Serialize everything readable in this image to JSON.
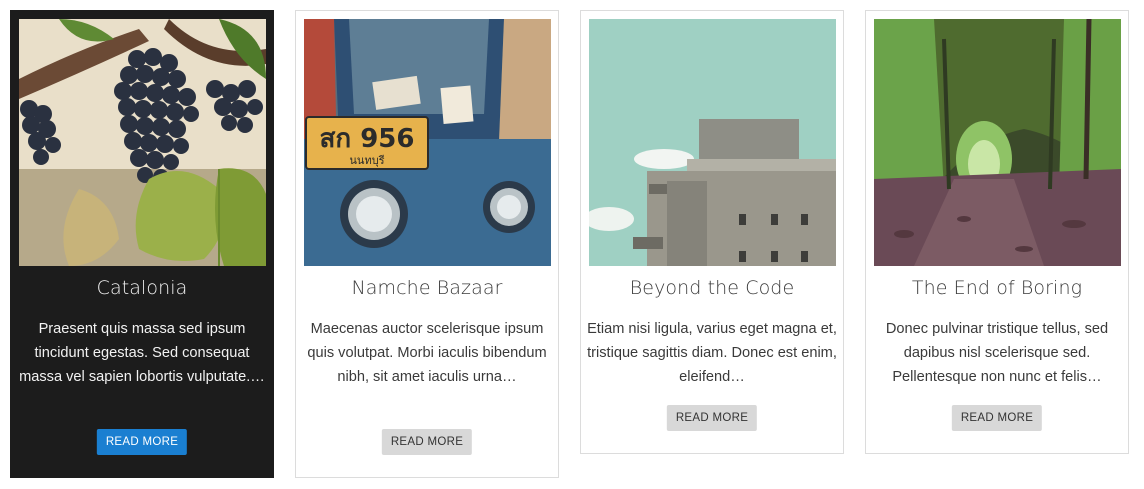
{
  "colors": {
    "dark_card_bg": "#1c1c1c",
    "accent_button": "#1a7fd1",
    "light_button": "#d8d8d8",
    "card_border": "#dcdcdc"
  },
  "cards": [
    {
      "title": "Catalonia",
      "excerpt": "Praesent quis massa sed ipsum tincidunt egestas. Sed consequat massa vel sapien lobortis vulputate.…",
      "button": "READ MORE",
      "image": "grapes-vineyard-photo"
    },
    {
      "title": "Namche Bazaar",
      "excerpt": "Maecenas auctor scelerisque ipsum quis volutpat. Morbi iaculis bibendum nibh, sit amet iaculis urna…",
      "button": "READ MORE",
      "image": "tuk-tuk-license-plate-photo",
      "plate": "สก 956",
      "plate_sub": "นนทบุรี"
    },
    {
      "title": "Beyond the Code",
      "excerpt": "Etiam nisi ligula, varius eget magna et, tristique sagittis diam. Donec est enim, eleifend…",
      "button": "READ MORE",
      "image": "concrete-bunker-building-photo"
    },
    {
      "title": "The End of Boring",
      "excerpt": "Donec pulvinar tristique tellus, sed dapibus nisl scelerisque sed. Pellentesque non nunc et felis…",
      "button": "READ MORE",
      "image": "tree-tunnel-path-photo"
    }
  ]
}
